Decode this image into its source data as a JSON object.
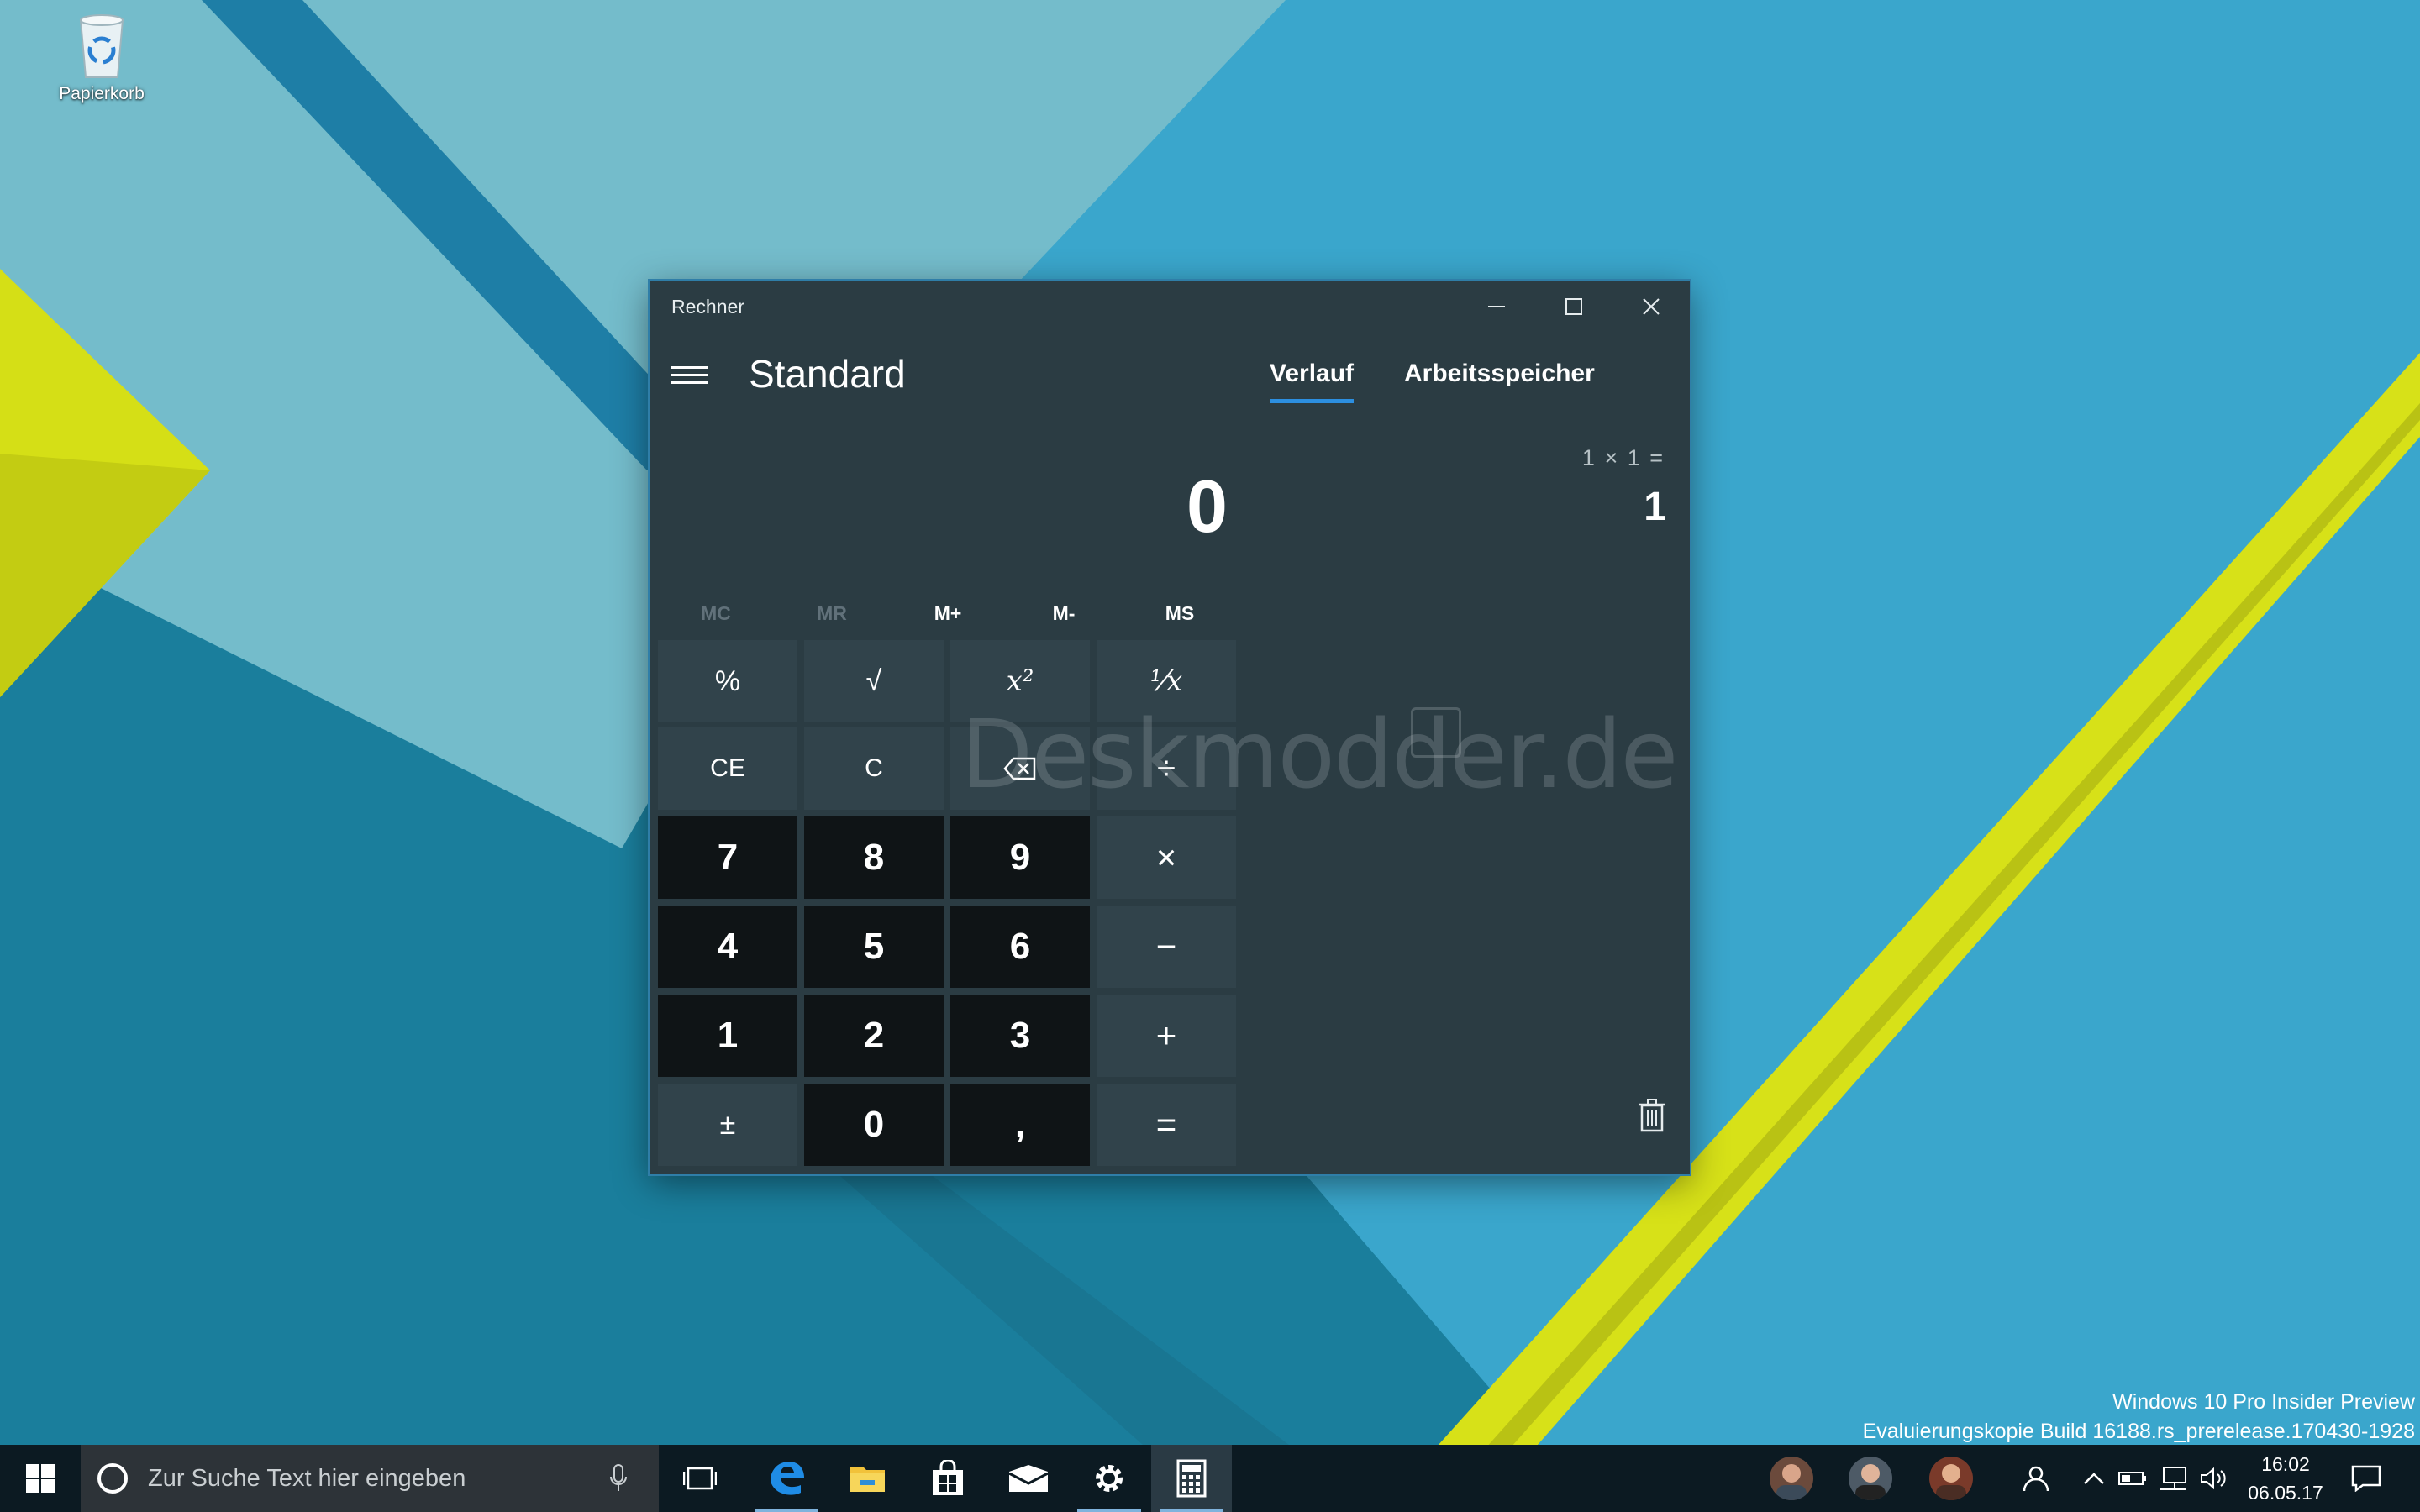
{
  "desktop": {
    "recycle_bin_label": "Papierkorb"
  },
  "window": {
    "title": "Rechner",
    "mode": "Standard",
    "tabs": [
      {
        "label": "Verlauf",
        "active": true
      },
      {
        "label": "Arbeitsspeicher",
        "active": false
      }
    ],
    "display_value": "0",
    "memory": [
      {
        "label": "MC",
        "enabled": false
      },
      {
        "label": "MR",
        "enabled": false
      },
      {
        "label": "M+",
        "enabled": true
      },
      {
        "label": "M-",
        "enabled": true
      },
      {
        "label": "MS",
        "enabled": true
      }
    ],
    "keys": {
      "percent": "%",
      "sqrt": "√",
      "square": "x²",
      "reciprocal": "¹⁄x",
      "ce": "CE",
      "c": "C",
      "divide": "÷",
      "k7": "7",
      "k8": "8",
      "k9": "9",
      "multiply": "×",
      "k4": "4",
      "k5": "5",
      "k6": "6",
      "minus": "−",
      "k1": "1",
      "k2": "2",
      "k3": "3",
      "plus": "+",
      "negate": "±",
      "k0": "0",
      "decimal": ",",
      "equals": "="
    },
    "history": {
      "expression": "1 × 1 =",
      "result": "1"
    },
    "watermark": "Deskmodder.de"
  },
  "build_info": {
    "line1": "Windows 10 Pro Insider Preview",
    "line2": "Evaluierungskopie Build 16188.rs_prerelease.170430-1928"
  },
  "taskbar": {
    "search_placeholder": "Zur Suche Text hier eingeben",
    "time": "16:02",
    "date": "06.05.17"
  },
  "colors": {
    "accent": "#2c8fe0",
    "window_bg": "#2b3c43",
    "taskbar_bg": "#0c1a22",
    "wallpaper_yellow": "#d6e21a"
  }
}
